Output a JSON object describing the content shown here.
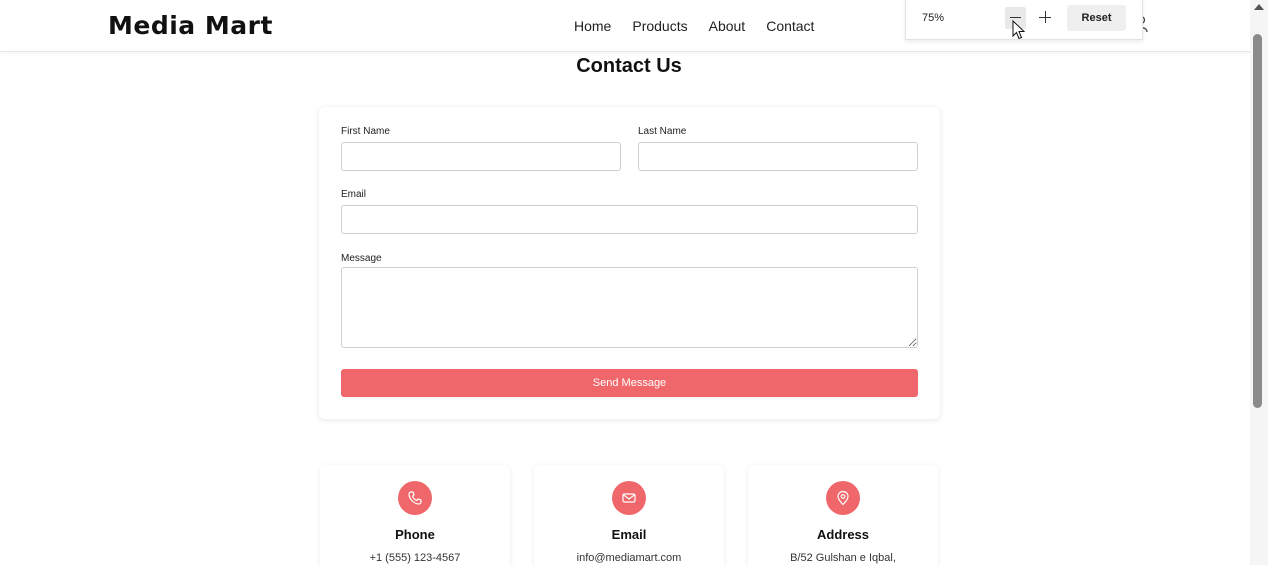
{
  "header": {
    "logo": "Media Mart",
    "nav": [
      "Home",
      "Products",
      "About",
      "Contact"
    ]
  },
  "zoom_popup": {
    "level": "75%",
    "reset_label": "Reset"
  },
  "main": {
    "title": "Contact Us",
    "form": {
      "first_name_label": "First Name",
      "last_name_label": "Last Name",
      "email_label": "Email",
      "message_label": "Message",
      "first_name_value": "",
      "last_name_value": "",
      "email_value": "",
      "message_value": "",
      "submit_label": "Send Message"
    },
    "info_cards": [
      {
        "icon": "phone-icon",
        "title": "Phone",
        "text": "+1 (555) 123-4567"
      },
      {
        "icon": "mail-icon",
        "title": "Email",
        "text": "info@mediamart.com"
      },
      {
        "icon": "location-pin-icon",
        "title": "Address",
        "text": "B/52 Gulshan e Iqbal,"
      }
    ]
  },
  "colors": {
    "accent": "#f0676b"
  }
}
